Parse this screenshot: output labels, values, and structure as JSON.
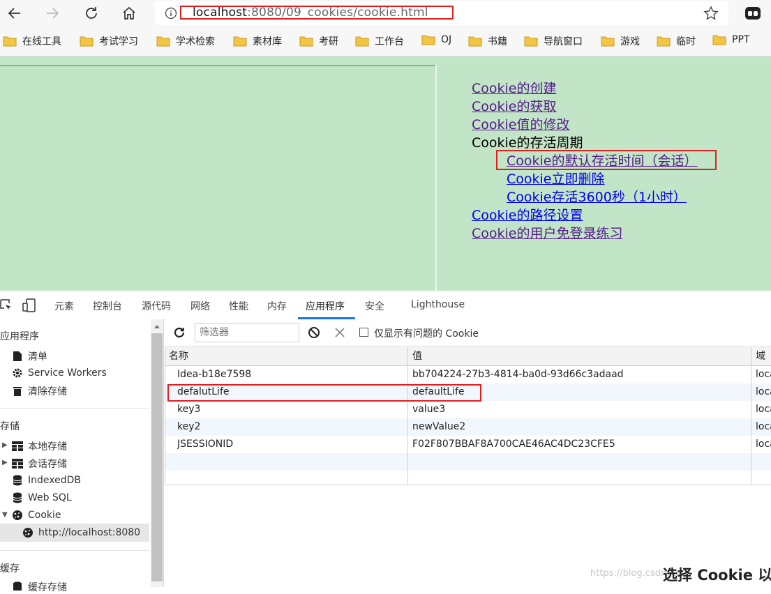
{
  "browser": {
    "url_host": "localhost",
    "url_path": ":8080/09_cookies/cookie.html"
  },
  "bookmarks": [
    "在线工具",
    "考试学习",
    "学术检索",
    "素材库",
    "考研",
    "工作台",
    "OJ",
    "书籍",
    "导航窗口",
    "游戏",
    "临时",
    "PPT"
  ],
  "page": {
    "links": {
      "create": "Cookie的创建",
      "get": "Cookie的获取",
      "modify": "Cookie值的修改",
      "lifecycle": "Cookie的存活周期",
      "default_life": "Cookie的默认存活时间（会话）",
      "delete_now": "Cookie立即删除",
      "life_3600": "Cookie存活3600秒（1小时）",
      "path": "Cookie的路径设置",
      "login": "Cookie的用户免登录练习"
    }
  },
  "devtools": {
    "tabs": [
      "元素",
      "控制台",
      "源代码",
      "网络",
      "性能",
      "内存",
      "应用程序",
      "安全",
      "Lighthouse"
    ],
    "active_tab": "应用程序",
    "sidebar": {
      "app_header": "应用程序",
      "manifest": "清单",
      "service_workers": "Service Workers",
      "clear_storage": "清除存储",
      "storage_header": "存储",
      "local_storage": "本地存储",
      "session_storage": "会话存储",
      "indexeddb": "IndexedDB",
      "websql": "Web SQL",
      "cookie": "Cookie",
      "cookie_origin": "http://localhost:8080",
      "cache_header": "缓存",
      "cache_storage": "缓存存储"
    },
    "cookie_toolbar": {
      "filter_placeholder": "筛选器",
      "only_issues_label": "仅显示有问题的 Cookie"
    },
    "table": {
      "headers": [
        "名称",
        "值",
        "域"
      ],
      "rows": [
        {
          "name": "Idea-b18e7598",
          "value": "bb704224-27b3-4814-ba0d-93d66c3adaad",
          "domain": "loca"
        },
        {
          "name": "defalutLife",
          "value": "defaultLife",
          "domain": "loca"
        },
        {
          "name": "key3",
          "value": "value3",
          "domain": "loca"
        },
        {
          "name": "key2",
          "value": "newValue2",
          "domain": "loca"
        },
        {
          "name": "JSESSIONID",
          "value": "F02F807BBAF8A700CAE46AC4DC23CFE5",
          "domain": "loca"
        }
      ]
    },
    "watermark": "https://blog.csdn.net/",
    "bottom_text": "选择 Cookie 以预"
  }
}
